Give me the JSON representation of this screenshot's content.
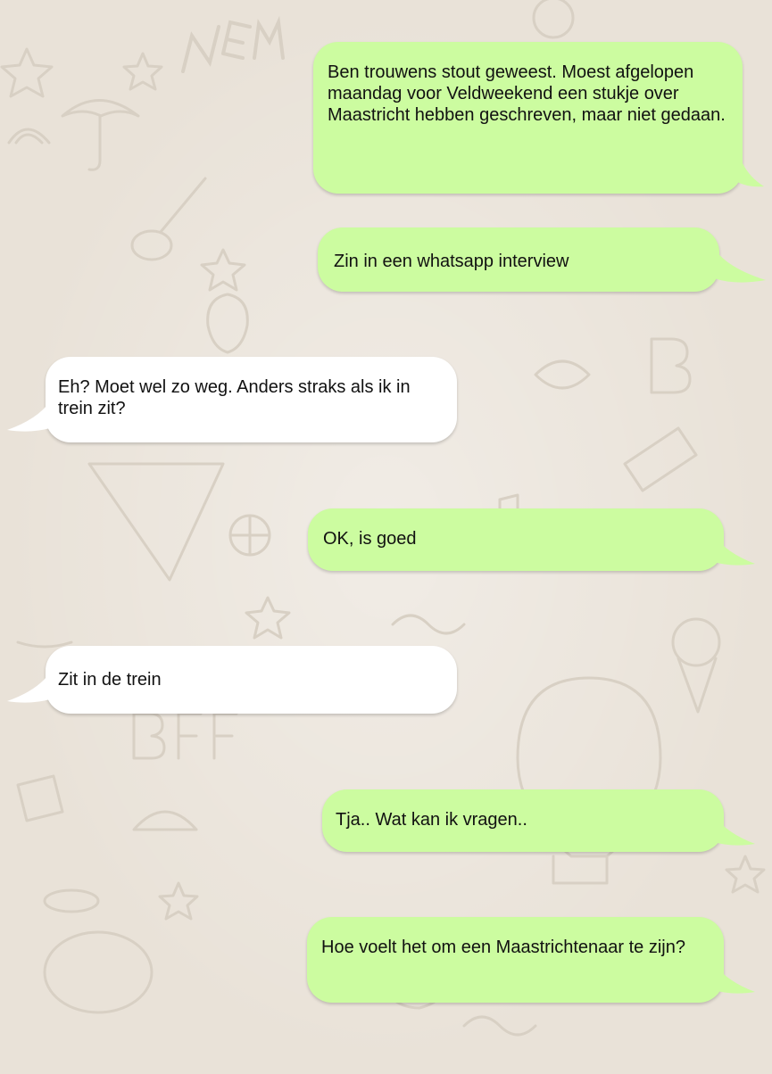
{
  "conversation": {
    "messages": [
      {
        "direction": "outgoing",
        "text": "Ben trouwens stout geweest. Moest afgelopen maandag voor Veldweekend een stukje over Maastricht hebben geschreven, maar niet gedaan."
      },
      {
        "direction": "outgoing",
        "text": "Zin in een whatsapp interview"
      },
      {
        "direction": "incoming",
        "text": "Eh? Moet wel zo weg. Anders straks als ik in trein zit?"
      },
      {
        "direction": "outgoing",
        "text": "OK, is goed"
      },
      {
        "direction": "incoming",
        "text": "Zit in de trein"
      },
      {
        "direction": "outgoing",
        "text": "Tja.. Wat kan ik vragen.."
      },
      {
        "direction": "outgoing",
        "text": "Hoe voelt het om een Maastrichtenaar te zijn?"
      }
    ]
  },
  "colors": {
    "outgoing_bubble": "#ccfca0",
    "incoming_bubble": "#ffffff",
    "background": "#e9e2d8",
    "doodle_stroke": "#d9d1c6"
  }
}
